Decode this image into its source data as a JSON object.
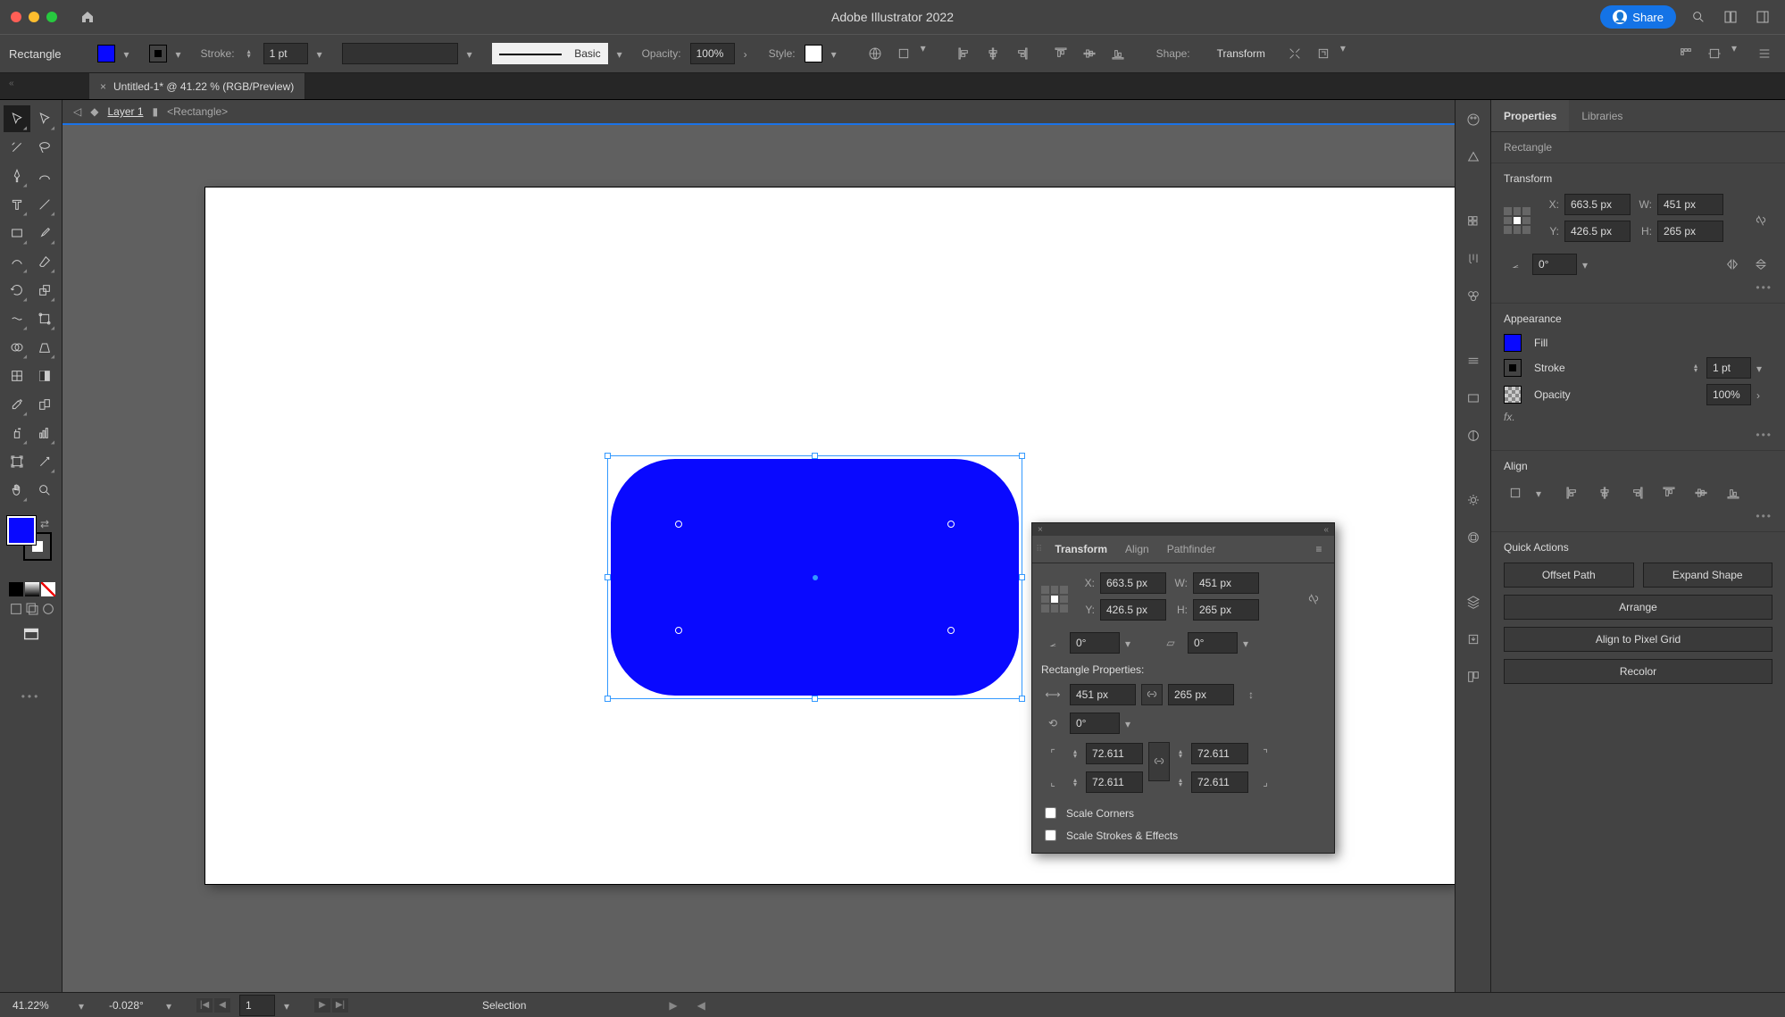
{
  "app_title": "Adobe Illustrator 2022",
  "share_label": "Share",
  "control_bar": {
    "selection_type": "Rectangle",
    "stroke_label": "Stroke:",
    "stroke_value": "1 pt",
    "brush_name": "Basic",
    "opacity_label": "Opacity:",
    "opacity_value": "100%",
    "style_label": "Style:",
    "shape_label": "Shape:",
    "transform_label": "Transform"
  },
  "tab": {
    "name": "Untitled-1* @ 41.22 % (RGB/Preview)"
  },
  "breadcrumb": {
    "layer": "Layer 1",
    "object": "<Rectangle>"
  },
  "float_panel": {
    "tabs": [
      "Transform",
      "Align",
      "Pathfinder"
    ],
    "x": "663.5 px",
    "y": "426.5 px",
    "w": "451 px",
    "h": "265 px",
    "rotate": "0°",
    "shear": "0°",
    "rect_title": "Rectangle Properties:",
    "rect_w": "451 px",
    "rect_h": "265 px",
    "rect_angle": "0°",
    "corner_tl": "72.611",
    "corner_tr": "72.611",
    "corner_bl": "72.611",
    "corner_br": "72.611",
    "scale_corners": "Scale Corners",
    "scale_strokes": "Scale Strokes & Effects"
  },
  "props": {
    "tabs": [
      "Properties",
      "Libraries"
    ],
    "obj_type": "Rectangle",
    "transform_title": "Transform",
    "x": "663.5 px",
    "y": "426.5 px",
    "w": "451 px",
    "h": "265 px",
    "angle": "0°",
    "appearance_title": "Appearance",
    "fill_label": "Fill",
    "stroke_label": "Stroke",
    "stroke_value": "1 pt",
    "opacity_label": "Opacity",
    "opacity_value": "100%",
    "fx_label": "fx.",
    "align_title": "Align",
    "quick_title": "Quick Actions",
    "qa": [
      "Offset Path",
      "Expand Shape",
      "Arrange",
      "Align to Pixel Grid",
      "Recolor"
    ]
  },
  "status": {
    "zoom": "41.22%",
    "rotation": "-0.028°",
    "artboard": "1",
    "tool": "Selection"
  }
}
